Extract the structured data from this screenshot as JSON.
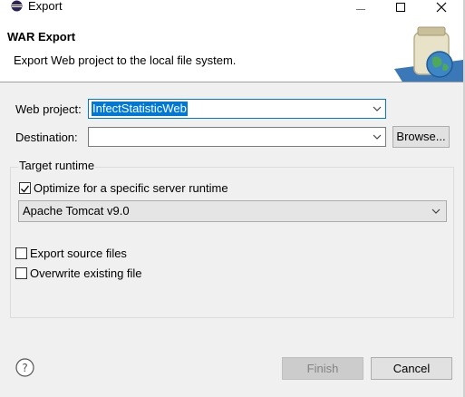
{
  "window": {
    "title": "Export",
    "icon": "eclipse-icon"
  },
  "header": {
    "title": "WAR Export",
    "description": "Export Web project to the local file system.",
    "banner_icon": "jar-globe-icon"
  },
  "form": {
    "web_project_label": "Web project:",
    "web_project_value": "InfectStatisticWeb",
    "destination_label": "Destination:",
    "destination_value": "",
    "browse_label": "Browse..."
  },
  "target_runtime": {
    "group_label": "Target runtime",
    "optimize_label": "Optimize for a specific server runtime",
    "optimize_checked": true,
    "runtime_value": "Apache Tomcat v9.0"
  },
  "options": {
    "export_source_label": "Export source files",
    "export_source_checked": false,
    "overwrite_label": "Overwrite existing file",
    "overwrite_checked": false
  },
  "buttons": {
    "help_icon": "help-icon",
    "finish_label": "Finish",
    "finish_enabled": false,
    "cancel_label": "Cancel"
  },
  "colors": {
    "selection": "#0078d7",
    "content_bg": "#f0f0f0"
  }
}
